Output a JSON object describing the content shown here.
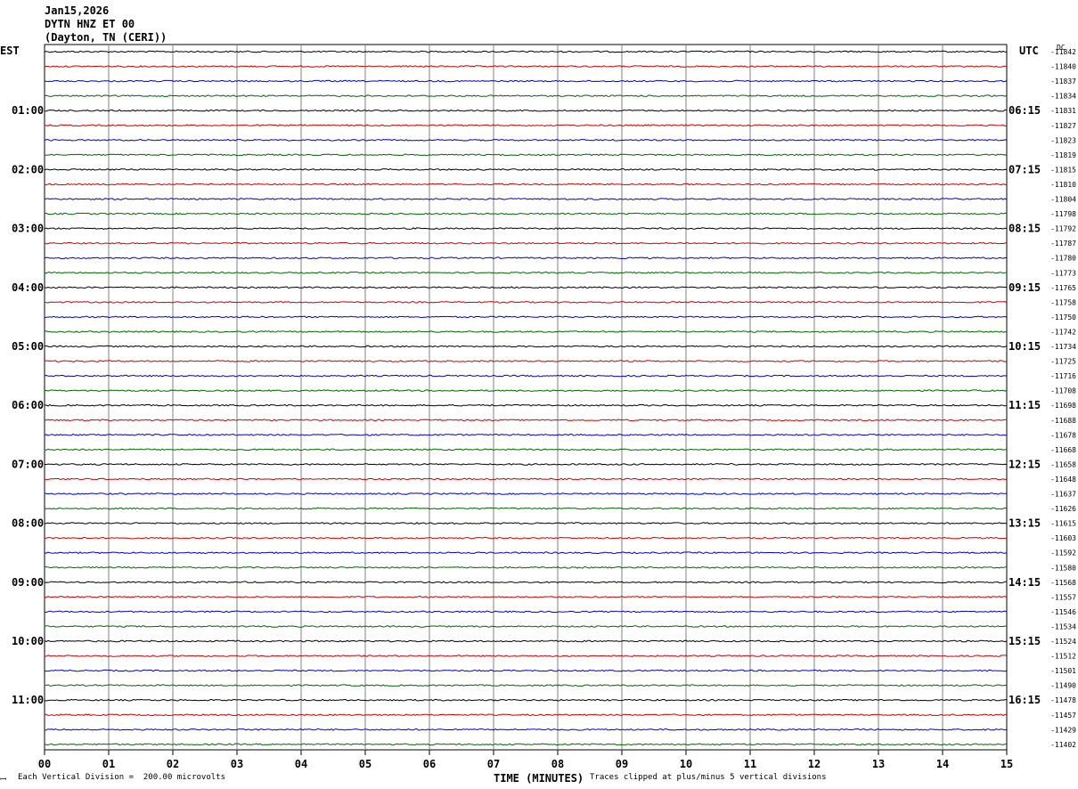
{
  "header": {
    "date": "Jan15,2026",
    "station": "DYTN HNZ ET 00",
    "location": "(Dayton, TN (CERI))"
  },
  "left_zone_label": "EST",
  "right_zone_label": "UTC",
  "dc_label": "DC",
  "footer": {
    "scale_note": "Each Vertical Division =  200.00 microvolts",
    "x_label": "TIME (MINUTES)",
    "clip_note": "Traces clipped at plus/minus 5 vertical divisions"
  },
  "colors": {
    "black": "#000000",
    "red": "#cc0000",
    "blue": "#0000cc",
    "green": "#006600",
    "grid": "#808080"
  },
  "chart_data": {
    "type": "line",
    "xlabel": "TIME (MINUTES)",
    "xlim": [
      0,
      15
    ],
    "x_ticks": [
      "00",
      "01",
      "02",
      "03",
      "04",
      "05",
      "06",
      "07",
      "08",
      "09",
      "10",
      "11",
      "12",
      "13",
      "14",
      "15"
    ],
    "trace_color_cycle": [
      "black",
      "red",
      "blue",
      "green"
    ],
    "left_time_labels": [
      {
        "trace_index": 4,
        "label": "01:00"
      },
      {
        "trace_index": 8,
        "label": "02:00"
      },
      {
        "trace_index": 12,
        "label": "03:00"
      },
      {
        "trace_index": 16,
        "label": "04:00"
      },
      {
        "trace_index": 20,
        "label": "05:00"
      },
      {
        "trace_index": 24,
        "label": "06:00"
      },
      {
        "trace_index": 28,
        "label": "07:00"
      },
      {
        "trace_index": 32,
        "label": "08:00"
      },
      {
        "trace_index": 36,
        "label": "09:00"
      },
      {
        "trace_index": 40,
        "label": "10:00"
      },
      {
        "trace_index": 44,
        "label": "11:00"
      }
    ],
    "right_time_labels": [
      {
        "trace_index": 4,
        "label": "06:15"
      },
      {
        "trace_index": 8,
        "label": "07:15"
      },
      {
        "trace_index": 12,
        "label": "08:15"
      },
      {
        "trace_index": 16,
        "label": "09:15"
      },
      {
        "trace_index": 20,
        "label": "10:15"
      },
      {
        "trace_index": 24,
        "label": "11:15"
      },
      {
        "trace_index": 28,
        "label": "12:15"
      },
      {
        "trace_index": 32,
        "label": "13:15"
      },
      {
        "trace_index": 36,
        "label": "14:15"
      },
      {
        "trace_index": 40,
        "label": "15:15"
      },
      {
        "trace_index": 44,
        "label": "16:15"
      }
    ],
    "dc_offsets": [
      "-11842",
      "-11840",
      "-11837",
      "-11834",
      "-11831",
      "-11827",
      "-11823",
      "-11819",
      "-11815",
      "-11810",
      "-11804",
      "-11798",
      "-11792",
      "-11787",
      "-11780",
      "-11773",
      "-11765",
      "-11758",
      "-11750",
      "-11742",
      "-11734",
      "-11725",
      "-11716",
      "-11708",
      "-11698",
      "-11688",
      "-11678",
      "-11668",
      "-11658",
      "-11648",
      "-11637",
      "-11626",
      "-11615",
      "-11603",
      "-11592",
      "-11580",
      "-11568",
      "-11557",
      "-11546",
      "-11534",
      "-11524",
      "-11512",
      "-11501",
      "-11490",
      "-11478",
      "-11457",
      "-11429",
      "-11402"
    ]
  }
}
